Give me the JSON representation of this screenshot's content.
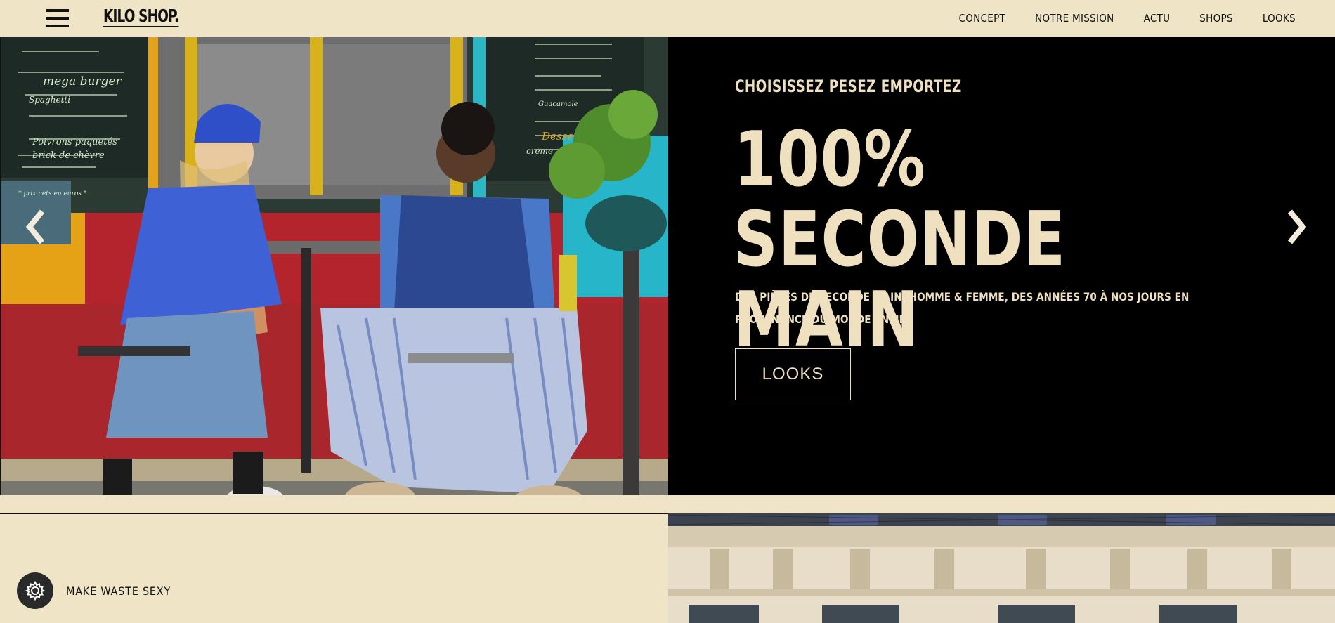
{
  "header": {
    "logo": "KILO SHOP.",
    "nav": [
      "CONCEPT",
      "NOTRE MISSION",
      "ACTU",
      "SHOPS",
      "LOOKS"
    ]
  },
  "hero": {
    "eyebrow": "CHOISISSEZ PESEZ EMPORTEZ",
    "headline": "100% SECONDE MAIN",
    "subtitle": "DES PIÈCES DE SECONDE MAIN, HOMME & FEMME, DES ANNÉES 70 À NOS JOURS EN PROVENANCE DU MONDE ENTIER",
    "cta_label": "LOOKS",
    "photo_board_lines": [
      "mega burger",
      "Spaghetti",
      "brick de chèvre",
      "Poivrons paquetés",
      "* prix nets en euros *",
      "Dessert",
      "Guacamole",
      "crème"
    ]
  },
  "footer_strip": {
    "tagline": "MAKE WASTE SEXY"
  },
  "icons": {
    "menu": "hamburger-menu-icon",
    "prev": "chevron-left-icon",
    "next": "chevron-right-icon",
    "settings": "gear-icon"
  },
  "colors": {
    "cream": "#efe5c6",
    "hero_text": "#efe0c0",
    "black": "#000000"
  }
}
